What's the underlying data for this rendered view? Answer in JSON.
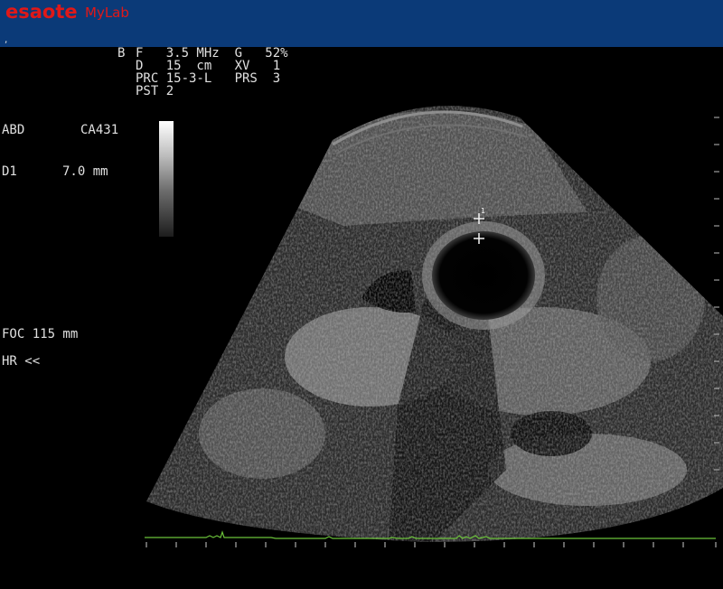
{
  "header": {
    "brand": "esaote",
    "product": "MyLab",
    "mark": ",",
    "bg_color": "#0b3a78",
    "logo_color": "#e01818"
  },
  "params": {
    "mode": "B",
    "line1": "F   3.5 MHz  G   52%",
    "line2": "D   15  cm   XV   1",
    "line3": "PRC 15-3-L   PRS  3",
    "line4": "PST 2"
  },
  "left_panel": {
    "app": "ABD",
    "probe": "CA431",
    "measure_name": "D1",
    "measure_value": "7.0 mm",
    "focus": "FOC 115 mm",
    "hr": "HR <<"
  },
  "ecg": {
    "color": "#6bc23a"
  }
}
